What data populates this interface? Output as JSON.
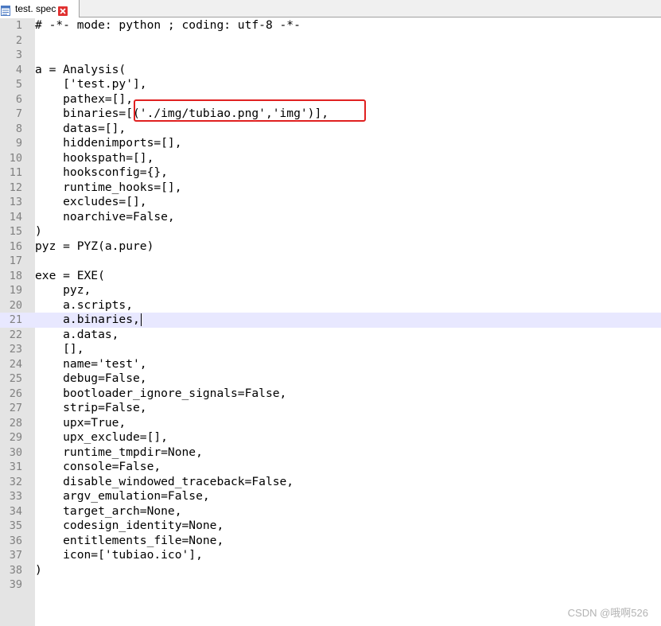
{
  "tab": {
    "filename": "test. spec",
    "file_icon": "file-icon",
    "close_icon": "close-icon"
  },
  "editor": {
    "current_line": 21,
    "highlighted_line": 7,
    "lines": [
      {
        "num": "1",
        "text": "# -*- mode: python ; coding: utf-8 -*-"
      },
      {
        "num": "2",
        "text": ""
      },
      {
        "num": "3",
        "text": ""
      },
      {
        "num": "4",
        "text": "a = Analysis("
      },
      {
        "num": "5",
        "text": "    ['test.py'],"
      },
      {
        "num": "6",
        "text": "    pathex=[],"
      },
      {
        "num": "7",
        "text": "    binaries=[('./img/tubiao.png','img')],"
      },
      {
        "num": "8",
        "text": "    datas=[],"
      },
      {
        "num": "9",
        "text": "    hiddenimports=[],"
      },
      {
        "num": "10",
        "text": "    hookspath=[],"
      },
      {
        "num": "11",
        "text": "    hooksconfig={},"
      },
      {
        "num": "12",
        "text": "    runtime_hooks=[],"
      },
      {
        "num": "13",
        "text": "    excludes=[],"
      },
      {
        "num": "14",
        "text": "    noarchive=False,"
      },
      {
        "num": "15",
        "text": ")"
      },
      {
        "num": "16",
        "text": "pyz = PYZ(a.pure)"
      },
      {
        "num": "17",
        "text": ""
      },
      {
        "num": "18",
        "text": "exe = EXE("
      },
      {
        "num": "19",
        "text": "    pyz,"
      },
      {
        "num": "20",
        "text": "    a.scripts,"
      },
      {
        "num": "21",
        "text": "    a.binaries,"
      },
      {
        "num": "22",
        "text": "    a.datas,"
      },
      {
        "num": "23",
        "text": "    [],"
      },
      {
        "num": "24",
        "text": "    name='test',"
      },
      {
        "num": "25",
        "text": "    debug=False,"
      },
      {
        "num": "26",
        "text": "    bootloader_ignore_signals=False,"
      },
      {
        "num": "27",
        "text": "    strip=False,"
      },
      {
        "num": "28",
        "text": "    upx=True,"
      },
      {
        "num": "29",
        "text": "    upx_exclude=[],"
      },
      {
        "num": "30",
        "text": "    runtime_tmpdir=None,"
      },
      {
        "num": "31",
        "text": "    console=False,"
      },
      {
        "num": "32",
        "text": "    disable_windowed_traceback=False,"
      },
      {
        "num": "33",
        "text": "    argv_emulation=False,"
      },
      {
        "num": "34",
        "text": "    target_arch=None,"
      },
      {
        "num": "35",
        "text": "    codesign_identity=None,"
      },
      {
        "num": "36",
        "text": "    entitlements_file=None,"
      },
      {
        "num": "37",
        "text": "    icon=['tubiao.ico'],"
      },
      {
        "num": "38",
        "text": ")"
      },
      {
        "num": "39",
        "text": ""
      }
    ]
  },
  "colors": {
    "gutter": "#e4e4e4",
    "current_line": "#e8e8ff",
    "highlight_border": "#e02020",
    "close_icon": "#e03030"
  },
  "watermark": "CSDN @哦啊526"
}
